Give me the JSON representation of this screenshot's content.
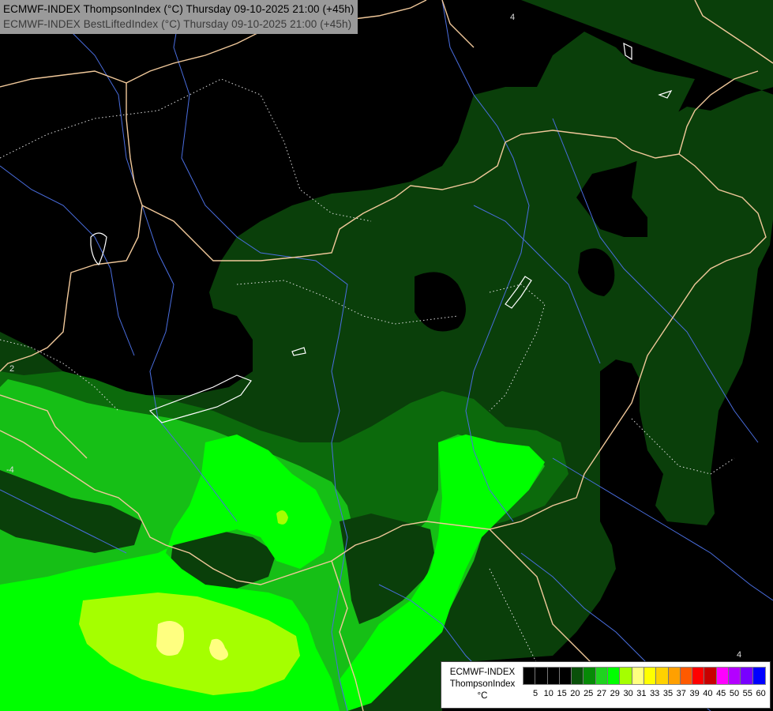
{
  "header": {
    "line1": "ECMWF-INDEX ThompsonIndex (°C) Thursday 09-10-2025 21:00 (+45h)",
    "line2": "ECMWF-INDEX BestLiftedIndex (°C) Thursday 09-10-2025 21:00 (+45h)"
  },
  "legend": {
    "model": "ECMWF-INDEX",
    "parameter": "ThompsonIndex",
    "unit": "°C",
    "ticks": [
      "5",
      "10",
      "15",
      "20",
      "25",
      "27",
      "29",
      "30",
      "31",
      "33",
      "35",
      "37",
      "39",
      "40",
      "45",
      "50",
      "55",
      "60"
    ],
    "colors": [
      "#000000",
      "#000000",
      "#000000",
      "#000000",
      "#0a500a",
      "#078a07",
      "#1fd21f",
      "#00ff00",
      "#a5ff00",
      "#ffff80",
      "#ffff00",
      "#ffd200",
      "#ffa000",
      "#ff5a00",
      "#ff0000",
      "#c80000",
      "#ff00ff",
      "#b400ff",
      "#7800ff",
      "#0000ff"
    ]
  },
  "colors": {
    "shade_1": "#0a3f0a",
    "shade_2": "#0c5a0c",
    "shade_3": "#16bf16",
    "shade_4": "#00ff00",
    "shade_5": "#a5ff00",
    "shade_6": "#ffff80",
    "borders": "#f0c89a",
    "rivers": "#4a6ee0",
    "isolines": "#dddddd"
  },
  "map_labels": [
    "2",
    "-4",
    "4",
    "4"
  ]
}
